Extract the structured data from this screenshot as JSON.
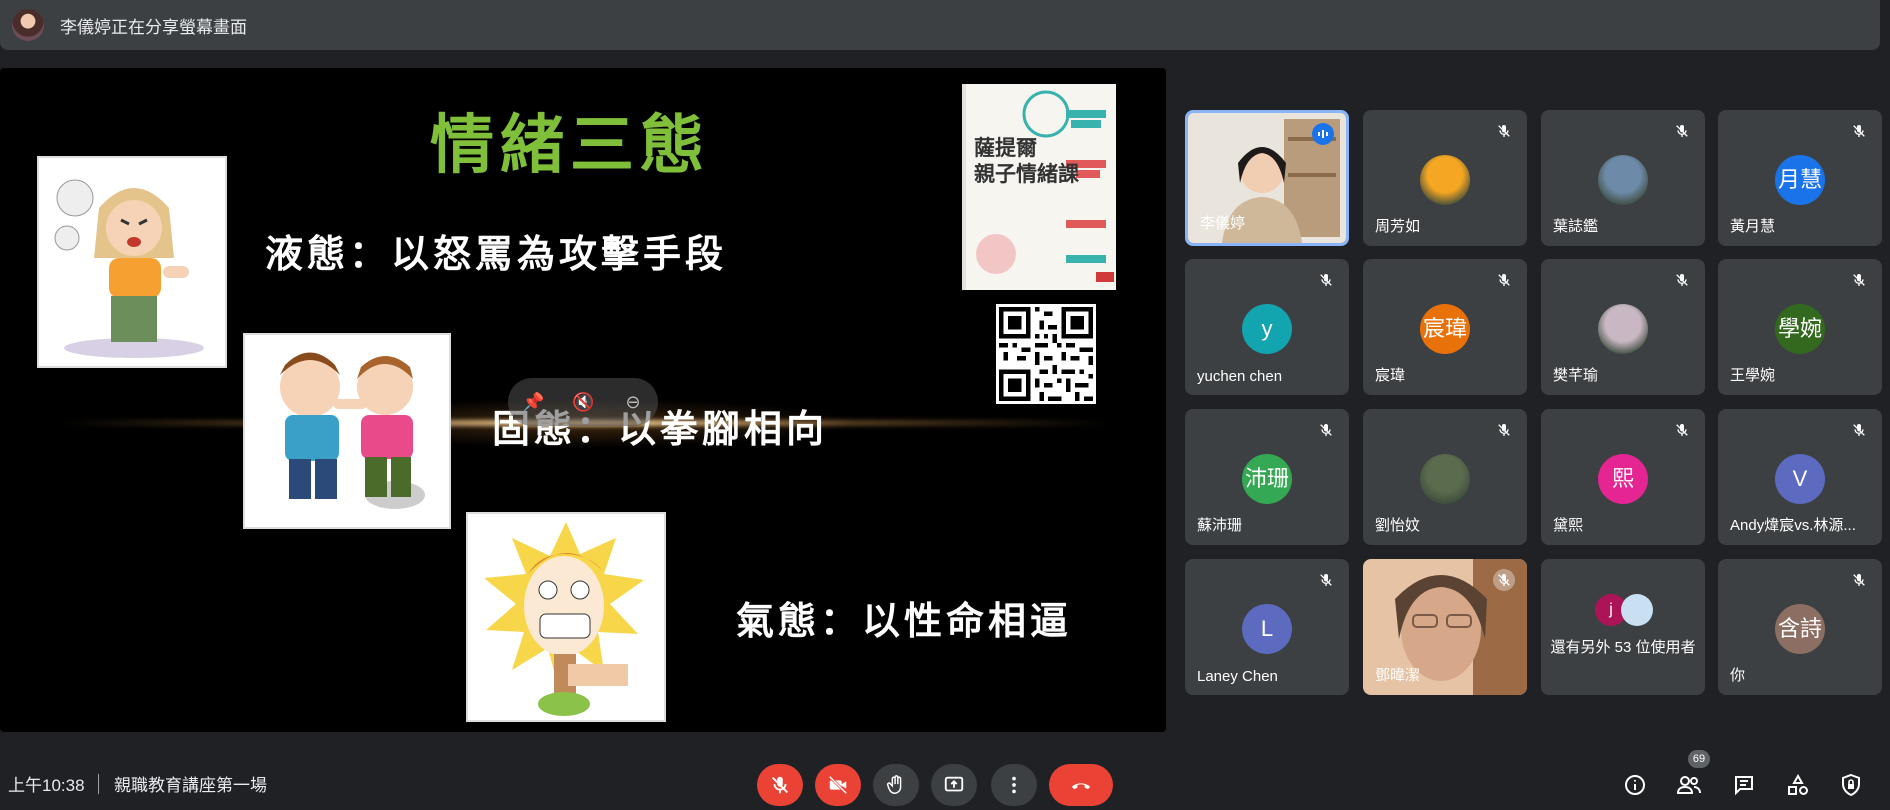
{
  "presenter_bar": {
    "title": "李儀婷正在分享螢幕畫面"
  },
  "slide": {
    "title": "情緒三態",
    "line1": "液態：以怒罵為攻擊手段",
    "line2": "固態：以拳腳相向",
    "line3": "氣態：以性命相逼",
    "book_title_1": "薩提爾",
    "book_title_2": "親子情緒課"
  },
  "participants": [
    {
      "name": "李儀婷",
      "type": "video",
      "active": true
    },
    {
      "name": "周芳如",
      "avatar_text": "",
      "type": "photo-avatar",
      "color": "#f5a623"
    },
    {
      "name": "葉誌鑑",
      "avatar_text": "",
      "type": "photo-avatar",
      "color": "#6d8aa8"
    },
    {
      "name": "黃月慧",
      "avatar_text": "月慧",
      "color": "#1a73e8"
    },
    {
      "name": "yuchen chen",
      "avatar_text": "y",
      "color": "#12a4af"
    },
    {
      "name": "宸瑋",
      "avatar_text": "宸瑋",
      "color": "#e8710a"
    },
    {
      "name": "樊芊瑜",
      "avatar_text": "",
      "type": "photo-avatar",
      "color": "#c9b8c4"
    },
    {
      "name": "王學婉",
      "avatar_text": "學婉",
      "color": "#33691e"
    },
    {
      "name": "蘇沛珊",
      "avatar_text": "沛珊",
      "color": "#34a853"
    },
    {
      "name": "劉怡妏",
      "avatar_text": "",
      "type": "photo-avatar",
      "color": "#5b6b4e"
    },
    {
      "name": "黛熙",
      "avatar_text": "熙",
      "color": "#e52592"
    },
    {
      "name": "Andy煒宸vs.林源...",
      "avatar_text": "V",
      "color": "#5c6bc0"
    },
    {
      "name": "Laney Chen",
      "avatar_text": "L",
      "color": "#5c6bc0"
    },
    {
      "name": "鄧暐潔",
      "type": "video"
    },
    {
      "name": "還有另外 53 位使用者",
      "type": "others",
      "avatar_text": "j"
    },
    {
      "name": "你",
      "avatar_text": "含詩",
      "color": "#8d6e63"
    }
  ],
  "bottom_bar": {
    "time": "上午10:38",
    "meeting_name": "親職教育講座第一場",
    "participant_count": "69"
  },
  "colors": {
    "danger": "#ea4335",
    "active_border": "#8ab4f8",
    "surface": "#3c4043"
  }
}
